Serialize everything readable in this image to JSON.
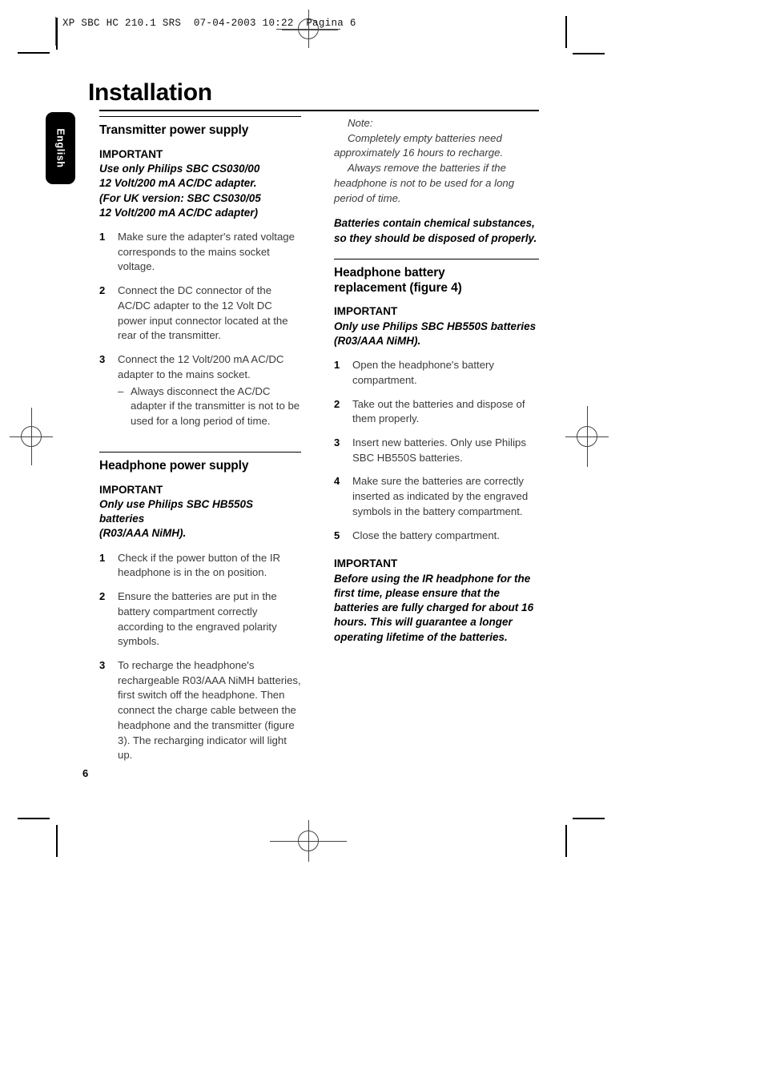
{
  "slug": {
    "text": "XP SBC HC 210.1 SRS  07-04-2003 10:22  Pagina 6"
  },
  "page": {
    "title": "Installation",
    "language_tab": "English",
    "page_number": "6"
  },
  "left_column": {
    "sections": [
      {
        "heading": "Transmitter power supply",
        "important_label": "IMPORTANT",
        "important_lines": [
          "Use only Philips SBC CS030/00",
          "12 Volt/200 mA AC/DC adapter.",
          "(For UK version: SBC CS030/05",
          "12 Volt/200 mA AC/DC adapter)"
        ],
        "steps": [
          {
            "number": "1",
            "text": "Make sure the adapter's rated voltage corresponds to the mains socket voltage."
          },
          {
            "number": "2",
            "text": "Connect the DC connector of the AC/DC adapter to the 12 Volt DC power input connector located at the rear of the transmitter."
          },
          {
            "number": "3",
            "text": "Connect the 12 Volt/200 mA AC/DC adapter to the mains socket.",
            "sub_dash": "–",
            "sub_text": "Always disconnect the AC/DC adapter if the transmitter is not to be used for a long period of time."
          }
        ]
      },
      {
        "heading": "Headphone power supply",
        "important_label": "IMPORTANT",
        "important_lines": [
          "Only use Philips SBC HB550S batteries",
          "(R03/AAA NiMH)."
        ],
        "steps": [
          {
            "number": "1",
            "text": "Check if the power button of the IR headphone is in the on position."
          },
          {
            "number": "2",
            "text": "Ensure the batteries are put in the battery compartment correctly according to the engraved polarity symbols."
          },
          {
            "number": "3",
            "text": "To recharge the headphone's rechargeable R03/AAA NiMH batteries, first switch off the headphone. Then connect the charge cable between the headphone and the transmitter (figure 3). The recharging indicator will light up."
          }
        ]
      }
    ]
  },
  "right_column": {
    "note": {
      "label": "Note:",
      "paragraph_1": "Completely empty batteries need approximately 16 hours to recharge.",
      "paragraph_2": "Always remove the batteries if the headphone is not to be used for a long period of time."
    },
    "warning": "Batteries contain chemical substances, so they should be disposed of properly.",
    "section": {
      "heading_line_1": "Headphone battery",
      "heading_line_2": "replacement (figure 4)",
      "important_label": "IMPORTANT",
      "important_lines": [
        "Only use Philips SBC HB550S batteries",
        "(R03/AAA NiMH)."
      ],
      "steps": [
        {
          "number": "1",
          "text": "Open the headphone's battery compartment."
        },
        {
          "number": "2",
          "text": "Take out the batteries and dispose of them properly."
        },
        {
          "number": "3",
          "text": "Insert new batteries. Only use Philips SBC HB550S batteries."
        },
        {
          "number": "4",
          "text": "Make sure the batteries are correctly inserted as indicated by the engraved symbols in the battery compartment."
        },
        {
          "number": "5",
          "text": "Close the battery compartment."
        }
      ]
    },
    "final_important": {
      "label": "IMPORTANT",
      "text": "Before using the IR headphone for the first time, please ensure that the batteries are fully charged for about 16 hours. This will guarantee a longer operating lifetime of the batteries."
    }
  }
}
